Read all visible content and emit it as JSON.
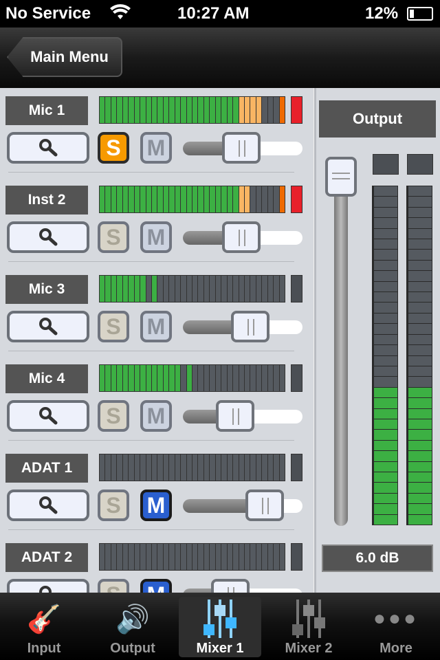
{
  "status": {
    "carrier": "No Service",
    "time": "10:27 AM",
    "battery": "12%"
  },
  "nav": {
    "back_label": "Main Menu"
  },
  "colors": {
    "meter_green": "#3cb043",
    "meter_orange": "#f9b563",
    "meter_hot": "#ef6a00",
    "clip_red": "#e8202a",
    "solo_on": "#f79a00",
    "mute_on": "#2a5fcf"
  },
  "meter_segments": 32,
  "channels": [
    {
      "name": "Mic 1",
      "level_segments": 28,
      "peak_segment": 32,
      "clip": true,
      "solo": true,
      "mute": false,
      "fader": 0.48,
      "solo_label": "S",
      "mute_label": "M"
    },
    {
      "name": "Inst 2",
      "level_segments": 26,
      "peak_segment": 32,
      "clip": true,
      "solo": false,
      "mute": false,
      "fader": 0.48,
      "solo_label": "S",
      "mute_label": "M"
    },
    {
      "name": "Mic 3",
      "level_segments": 8,
      "peak_segment": 10,
      "clip": false,
      "solo": false,
      "mute": false,
      "fader": 0.59,
      "solo_label": "S",
      "mute_label": "M"
    },
    {
      "name": "Mic 4",
      "level_segments": 14,
      "peak_segment": 16,
      "clip": false,
      "solo": false,
      "mute": false,
      "fader": 0.41,
      "solo_label": "S",
      "mute_label": "M"
    },
    {
      "name": "ADAT 1",
      "level_segments": 0,
      "peak_segment": 0,
      "clip": false,
      "solo": false,
      "mute": true,
      "fader": 0.77,
      "solo_label": "S",
      "mute_label": "M"
    },
    {
      "name": "ADAT 2",
      "level_segments": 0,
      "peak_segment": 0,
      "clip": false,
      "solo": false,
      "mute": true,
      "fader": 0.35,
      "solo_label": "S",
      "mute_label": "M"
    }
  ],
  "output": {
    "label": "Output",
    "gain": "6.0 dB",
    "fader": 1.0,
    "meter_segments": 32,
    "left_level": 13,
    "right_level": 13
  },
  "tabs": [
    {
      "label": "Input",
      "icon": "guitar-mic-icon"
    },
    {
      "label": "Output",
      "icon": "speaker-icon"
    },
    {
      "label": "Mixer 1",
      "icon": "mixer-icon",
      "active": true
    },
    {
      "label": "Mixer 2",
      "icon": "mixer-icon"
    },
    {
      "label": "More",
      "icon": "more-dots-icon"
    }
  ]
}
